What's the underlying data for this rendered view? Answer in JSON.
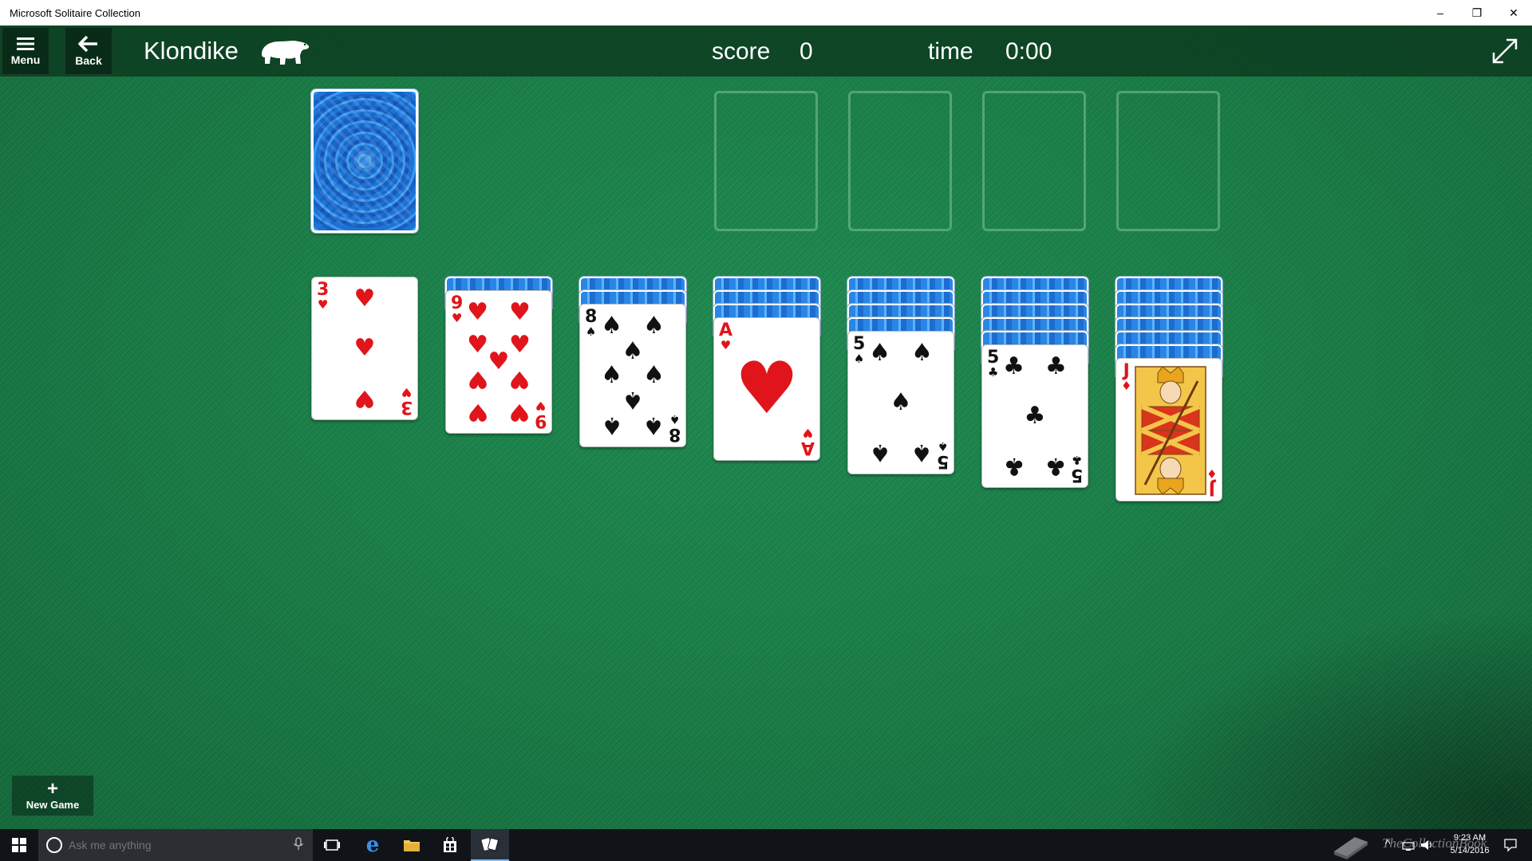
{
  "window": {
    "title": "Microsoft Solitaire Collection",
    "controls": {
      "minimize": "–",
      "maximize": "❐",
      "close": "✕"
    }
  },
  "toolbar": {
    "menu_label": "Menu",
    "back_label": "Back",
    "game_title": "Klondike",
    "score_label": "score",
    "score_value": "0",
    "time_label": "time",
    "time_value": "0:00"
  },
  "stock": {
    "face_down": true
  },
  "foundations": {
    "count": 4,
    "empty": true
  },
  "tableau": [
    {
      "hidden": 0,
      "top": {
        "rank": "3",
        "suit": "♥",
        "color": "red"
      }
    },
    {
      "hidden": 1,
      "top": {
        "rank": "9",
        "suit": "♥",
        "color": "red"
      }
    },
    {
      "hidden": 2,
      "top": {
        "rank": "8",
        "suit": "♠",
        "color": "black"
      }
    },
    {
      "hidden": 3,
      "top": {
        "rank": "A",
        "suit": "♥",
        "color": "red"
      }
    },
    {
      "hidden": 4,
      "top": {
        "rank": "5",
        "suit": "♠",
        "color": "black"
      }
    },
    {
      "hidden": 5,
      "top": {
        "rank": "5",
        "suit": "♣",
        "color": "black"
      }
    },
    {
      "hidden": 6,
      "top": {
        "rank": "J",
        "suit": "♦",
        "color": "red"
      }
    }
  ],
  "new_game": {
    "icon": "+",
    "label": "New Game"
  },
  "taskbar": {
    "search_placeholder": "Ask me anything",
    "clock_time": "9:23 AM",
    "clock_date": "5/14/2016",
    "watermark": "TheCollectionBook"
  },
  "colors": {
    "felt": "#177a44",
    "toolbar": "#0c3c20",
    "card_back": "#1e6fd6",
    "red_suit": "#e0151b",
    "black_suit": "#111111"
  }
}
